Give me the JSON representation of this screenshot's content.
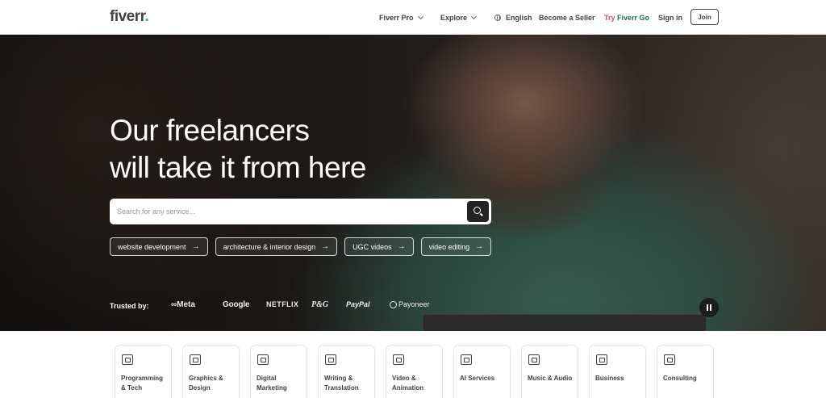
{
  "header": {
    "logo": "fiverr",
    "logo_dot": ".",
    "nav": {
      "fiverr_pro": "Fiverr Pro",
      "explore": "Explore",
      "language": "English",
      "become_seller": "Become a Seller",
      "try_prefix": "Try ",
      "try_go": "Fiverr Go",
      "sign_in": "Sign in",
      "join": "Join"
    }
  },
  "hero": {
    "title_line1": "Our freelancers",
    "title_line2": "will take it from here",
    "search": {
      "placeholder": "Search for any service..."
    },
    "chips": [
      {
        "label": "website development",
        "arrow": "→"
      },
      {
        "label": "architecture & interior design",
        "arrow": "→"
      },
      {
        "label": "UGC videos",
        "arrow": "→"
      },
      {
        "label": "video editing",
        "arrow": "→"
      }
    ],
    "trusted_label": "Trusted by:",
    "brands": {
      "meta": "∞Meta",
      "google": "Google",
      "netflix": "NETFLIX",
      "pg": "P&G",
      "paypal": "PayPal",
      "payoneer": "Payoneer"
    }
  },
  "categories": [
    {
      "line1": "Programming",
      "line2": "& Tech",
      "icon": "programming-icon"
    },
    {
      "line1": "Graphics &",
      "line2": "Design",
      "icon": "graphics-icon"
    },
    {
      "line1": "Digital",
      "line2": "Marketing",
      "icon": "marketing-icon"
    },
    {
      "line1": "Writing &",
      "line2": "Translation",
      "icon": "writing-icon"
    },
    {
      "line1": "Video &",
      "line2": "Animation",
      "icon": "video-icon"
    },
    {
      "line1": "AI Services",
      "line2": "",
      "icon": "ai-icon"
    },
    {
      "line1": "Music & Audio",
      "line2": "",
      "icon": "music-icon"
    },
    {
      "line1": "Business",
      "line2": "",
      "icon": "business-icon"
    },
    {
      "line1": "Consulting",
      "line2": "",
      "icon": "consulting-icon"
    }
  ],
  "colors": {
    "brand_green": "#1dbf73",
    "text_dark": "#404145",
    "try_pink": "#c7506b",
    "go_green": "#1e6e5a"
  }
}
